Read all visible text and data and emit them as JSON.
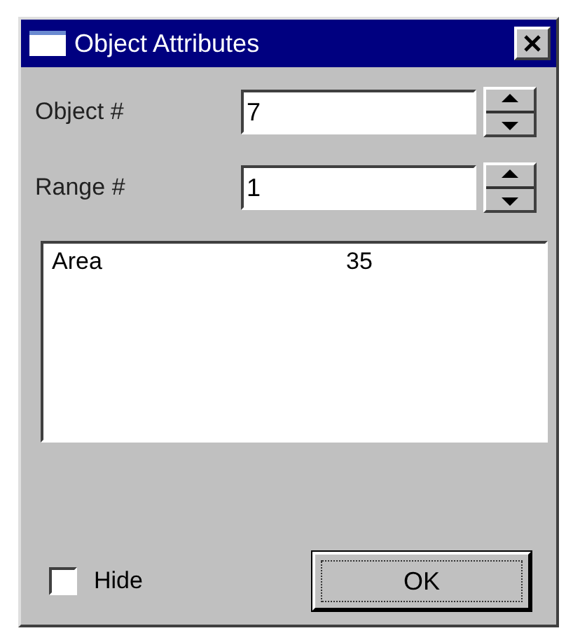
{
  "window": {
    "title": "Object Attributes"
  },
  "fields": [
    {
      "label": "Object #",
      "value": "7"
    },
    {
      "label": "Range #",
      "value": "1"
    }
  ],
  "list": {
    "rows": [
      {
        "name": "Area",
        "value": "35"
      }
    ]
  },
  "hide_checkbox": {
    "label": "Hide",
    "checked": false
  },
  "ok_button": {
    "label": "OK",
    "focused": true
  }
}
